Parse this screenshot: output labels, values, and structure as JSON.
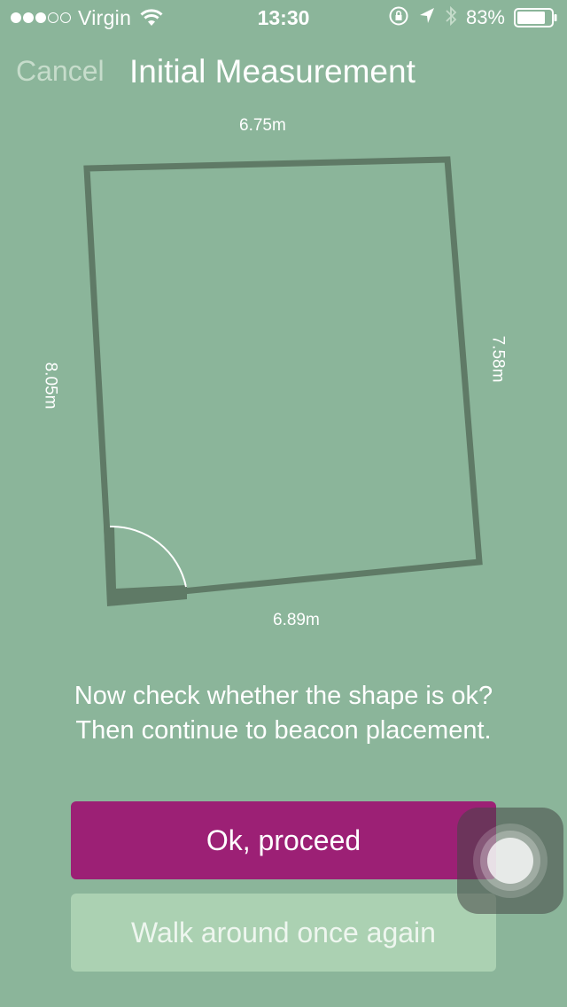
{
  "status_bar": {
    "carrier": "Virgin",
    "signal_bars_filled": 3,
    "signal_bars_total": 5,
    "time": "13:30",
    "battery_percent": "83%",
    "icons": [
      "wifi-icon",
      "orientation-lock-icon",
      "location-arrow-icon",
      "bluetooth-icon",
      "battery-icon"
    ]
  },
  "nav": {
    "cancel_label": "Cancel",
    "title": "Initial Measurement"
  },
  "room": {
    "top_length": "6.75m",
    "right_length": "7.58m",
    "bottom_length": "6.89m",
    "left_length": "8.05m"
  },
  "message": {
    "line1": "Now check whether the shape is ok?",
    "line2": "Then continue to beacon placement."
  },
  "buttons": {
    "proceed_label": "Ok, proceed",
    "walk_again_label": "Walk around once again"
  },
  "colors": {
    "background": "#8bb59a",
    "wall": "#5f7a66",
    "primary_button": "#9c2075",
    "secondary_button": "#abd1b2"
  }
}
